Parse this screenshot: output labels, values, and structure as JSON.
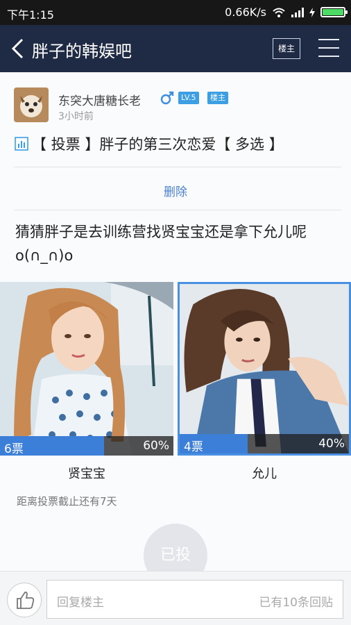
{
  "status_bar": {
    "time": "下午1:15",
    "speed": "0.66K/s"
  },
  "nav": {
    "title": "胖子的韩娱吧",
    "louzhu_button": "楼主"
  },
  "post": {
    "username": "东突大唐糖长老",
    "level": "LV.5",
    "louzhu_tag": "楼主",
    "time": "3小时前",
    "title": "【 投票 】胖子的第三次恋爱【 多选 】",
    "delete_label": "删除",
    "question": "猜猜胖子是去训练营找贤宝宝还是拿下允儿呢o(∩_∩)o"
  },
  "poll": {
    "options": [
      {
        "name": "贤宝宝",
        "votes_text": "6票",
        "percent_text": "60%",
        "percent": 0.6,
        "selected": false
      },
      {
        "name": "允儿",
        "votes_text": "4票",
        "percent_text": "40%",
        "percent": 0.4,
        "selected": true
      }
    ],
    "deadline": "距离投票截止还有7天",
    "voted_label": "已投"
  },
  "bottom": {
    "reply_placeholder": "回复楼主",
    "reply_count": "已有10条回贴"
  },
  "colors": {
    "nav_bg": "#1f2a45",
    "accent": "#3b7fd8",
    "tag_blue": "#3c9fe4"
  }
}
